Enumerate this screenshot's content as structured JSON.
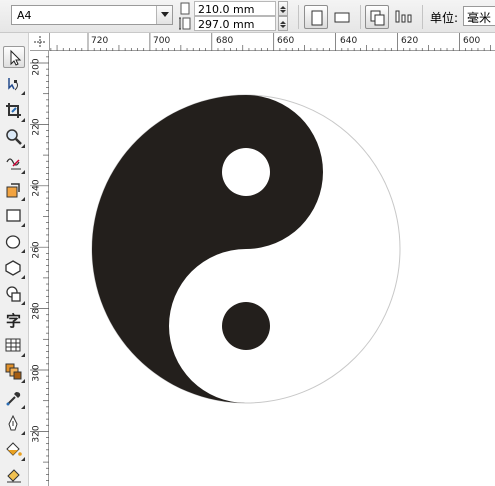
{
  "property_bar": {
    "paper_size": "A4",
    "width_value": "210.0 mm",
    "height_value": "297.0 mm",
    "unit_label": "单位:",
    "unit_value": "毫米"
  },
  "toolbox": {
    "tools": [
      "pick-tool",
      "shape-tool",
      "crop-tool",
      "zoom-tool",
      "freehand-tool",
      "smart-fill-tool",
      "rectangle-tool",
      "ellipse-tool",
      "polygon-tool",
      "basic-shapes-tool",
      "text-tool",
      "table-tool",
      "interactive-blend-tool",
      "eyedropper-tool",
      "outline-pen-tool",
      "fill-tool",
      "interactive-fill-tool"
    ],
    "text_tool_glyph": "字"
  },
  "rulers": {
    "horizontal_labels": [
      "720",
      "700",
      "680",
      "660",
      "640",
      "620",
      "600"
    ],
    "vertical_labels": [
      "200",
      "220",
      "240",
      "260",
      "280",
      "300",
      "320"
    ]
  },
  "drawing": {
    "object": "yin-yang-symbol",
    "dark_color": "#231f1c",
    "light_color": "#ffffff",
    "outline_color": "#c8c8c8"
  }
}
